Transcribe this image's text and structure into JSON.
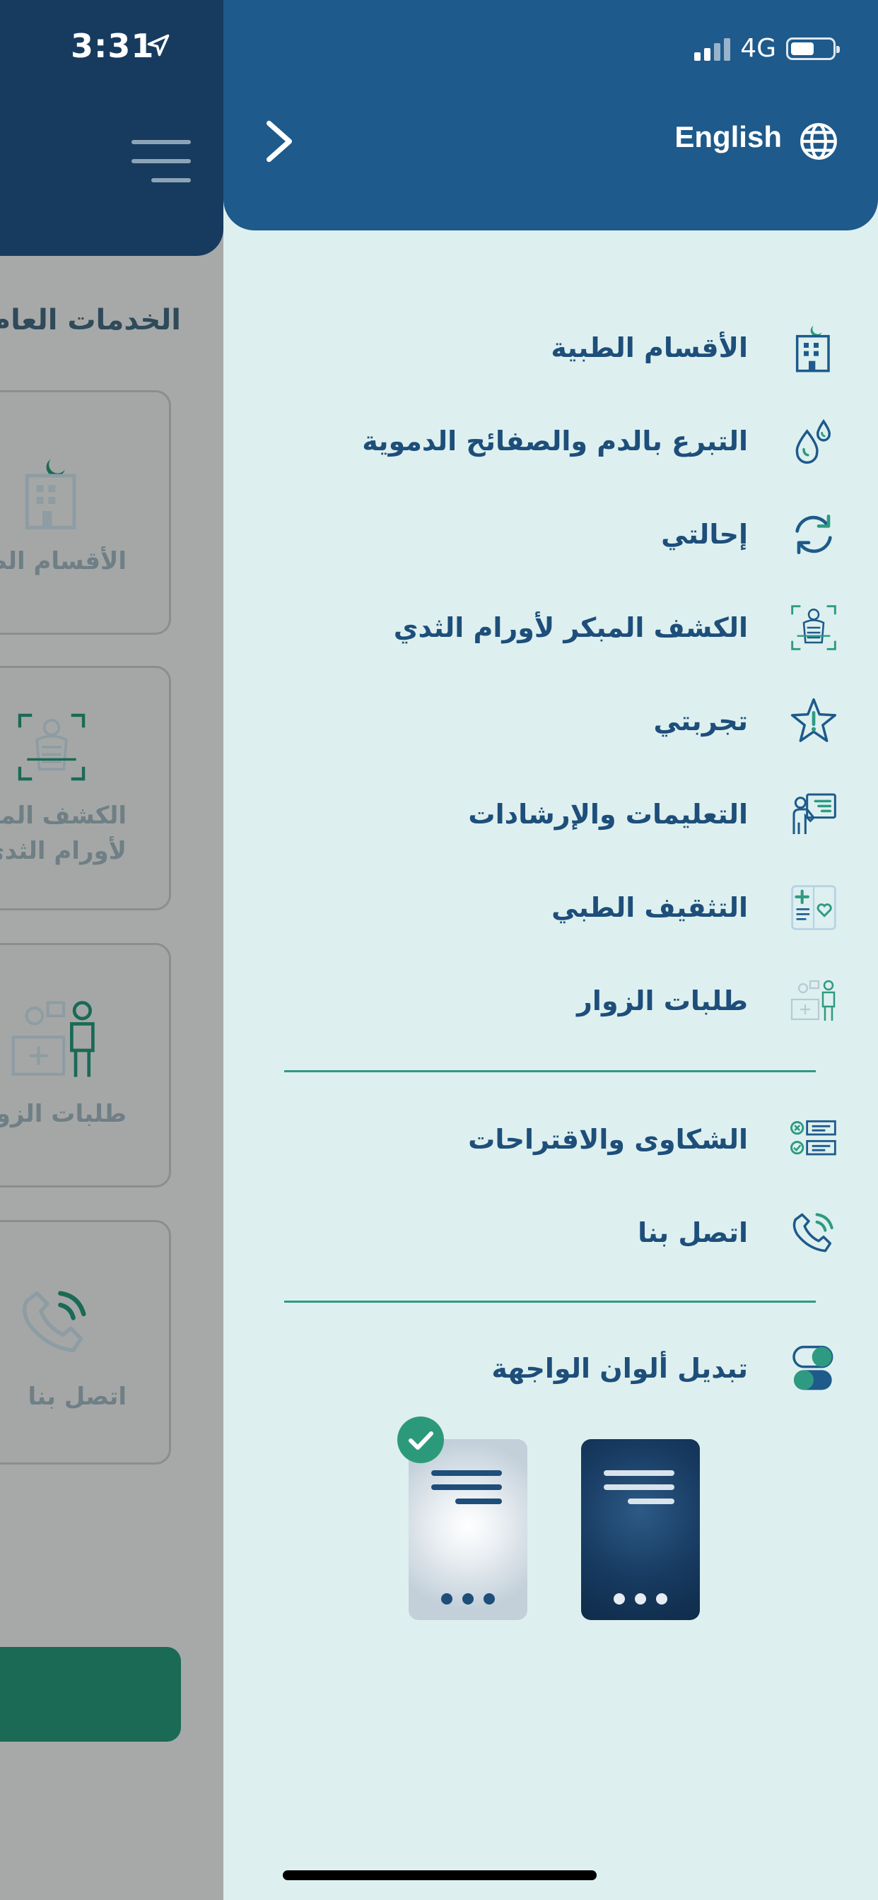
{
  "status_bar": {
    "time": "3:31",
    "network": "4G"
  },
  "background_screen": {
    "section_title": "الخدمات العام",
    "cards": [
      {
        "label": "الأقسام الطب",
        "icon": "hospital-building-icon"
      },
      {
        "label_line1": "الكشف المبك",
        "label_line2": "لأورام الثدي",
        "icon": "breast-screening-icon"
      },
      {
        "label": "طلبات الزوا",
        "icon": "visitors-desk-icon"
      },
      {
        "label": "اتصل بنا",
        "icon": "phone-call-icon"
      }
    ]
  },
  "drawer": {
    "language_label": "English",
    "menu": [
      {
        "label": "الأقسام الطبية",
        "icon": "hospital-building-icon"
      },
      {
        "label": "التبرع بالدم والصفائح الدموية",
        "icon": "blood-drops-icon"
      },
      {
        "label": "إحالتي",
        "icon": "refresh-arrows-icon"
      },
      {
        "label": "الكشف المبكر لأورام الثدي",
        "icon": "breast-screening-icon"
      },
      {
        "label": "تجربتي",
        "icon": "star-alert-icon"
      },
      {
        "label": "التعليمات والإرشادات",
        "icon": "instructions-icon"
      },
      {
        "label": "التثقيف الطبي",
        "icon": "medical-education-icon"
      },
      {
        "label": "طلبات الزوار",
        "icon": "visitors-icon"
      }
    ],
    "support_menu": [
      {
        "label": "الشكاوى والاقتراحات",
        "icon": "complaints-checklist-icon"
      },
      {
        "label": "اتصل بنا",
        "icon": "phone-call-icon"
      }
    ],
    "theme_section": {
      "label": "تبديل ألوان الواجهة",
      "icon": "toggle-switches-icon",
      "options": [
        {
          "name": "light",
          "selected": true
        },
        {
          "name": "dark",
          "selected": false
        }
      ]
    }
  },
  "colors": {
    "header_blue": "#1e5a8b",
    "drawer_bg": "#ddf0ef",
    "label_blue": "#1e4e7a",
    "accent_green": "#2e9a82"
  }
}
